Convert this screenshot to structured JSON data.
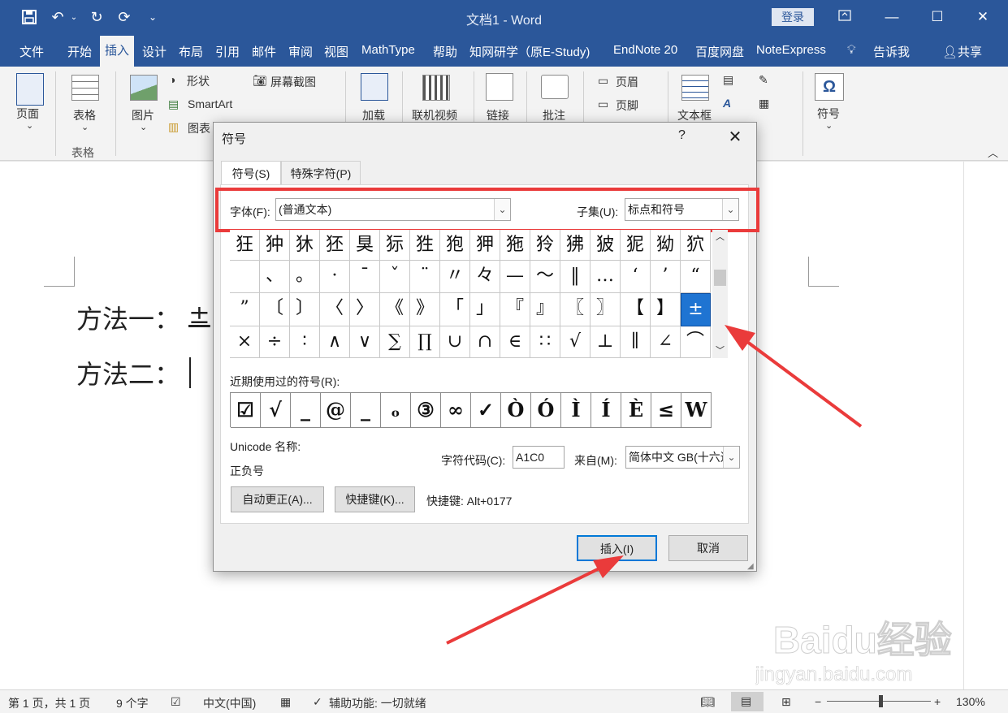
{
  "titlebar": {
    "doc_title": "文档1  -  Word",
    "login": "登录"
  },
  "tabs": [
    "文件",
    "开始",
    "插入",
    "设计",
    "布局",
    "引用",
    "邮件",
    "审阅",
    "视图",
    "MathType",
    "帮助",
    "知网研学（原E-Study)",
    "EndNote 20",
    "百度网盘",
    "NoteExpress",
    "告诉我",
    "共享"
  ],
  "ribbon": {
    "page": "页面",
    "table": "表格",
    "table_group": "表格",
    "picture": "图片",
    "shapes": "形状",
    "smartart": "SmartArt",
    "chart": "图表",
    "screenshot": "屏幕截图",
    "addin": "加载",
    "online_video": "联机视频",
    "link": "链接",
    "comment": "批注",
    "header": "页眉",
    "footer": "页脚",
    "textbox": "文本框",
    "symbol": "符号"
  },
  "document": {
    "line1": "方法一：",
    "line1_symbol": "±",
    "line2": "方法二："
  },
  "dialog": {
    "title": "符号",
    "help": "?",
    "tab_symbols": "符号(S)",
    "tab_special": "特殊字符(P)",
    "font_label": "字体(F):",
    "font_value": "(普通文本)",
    "subset_label": "子集(U):",
    "subset_value": "标点和符号",
    "grid": [
      [
        "狂",
        "狆",
        "狇",
        "狉",
        "狊",
        "狋",
        "狌",
        "狍",
        "狎",
        "狏",
        "狑",
        "狒",
        "狓",
        "狔",
        "狕",
        "狖"
      ],
      [
        "",
        "、",
        "。",
        "·",
        "ˉ",
        "ˇ",
        "¨",
        "〃",
        "々",
        "—",
        "～",
        "‖",
        "…",
        "‘",
        "’",
        "“"
      ],
      [
        "”",
        "〔",
        "〕",
        "〈",
        "〉",
        "《",
        "》",
        "「",
        "」",
        "『",
        "』",
        "〖",
        "〗",
        "【",
        "】",
        "±"
      ],
      [
        "×",
        "÷",
        "∶",
        "∧",
        "∨",
        "∑",
        "∏",
        "∪",
        "∩",
        "∈",
        "∷",
        "√",
        "⊥",
        "∥",
        "∠",
        "⌒"
      ]
    ],
    "recent_label": "近期使用过的符号(R):",
    "recent": [
      "☑",
      "√",
      "_",
      "@",
      "_",
      "ₒ",
      "③",
      "∞",
      "✓",
      "Ò",
      "Ó",
      "Ì",
      "Í",
      "È",
      "≤",
      "W"
    ],
    "unicode_label": "Unicode 名称:",
    "unicode_name": "正负号",
    "charcode_label": "字符代码(C):",
    "charcode_value": "A1C0",
    "from_label": "来自(M):",
    "from_value": "简体中文 GB(十六进制)",
    "autocorrect": "自动更正(A)...",
    "shortcut_btn": "快捷键(K)...",
    "shortcut_text": "快捷键: Alt+0177",
    "insert": "插入(I)",
    "cancel": "取消"
  },
  "statusbar": {
    "page": "第 1 页，共 1 页",
    "words": "9 个字",
    "lang": "中文(中国)",
    "access": "辅助功能: 一切就绪",
    "zoom": "130%"
  },
  "watermark": {
    "brand": "Baidu经验",
    "url": "jingyan.baidu.com"
  },
  "colors": {
    "brand": "#2b579a",
    "highlight": "#ea3b3b",
    "selected": "#1f74d2"
  }
}
